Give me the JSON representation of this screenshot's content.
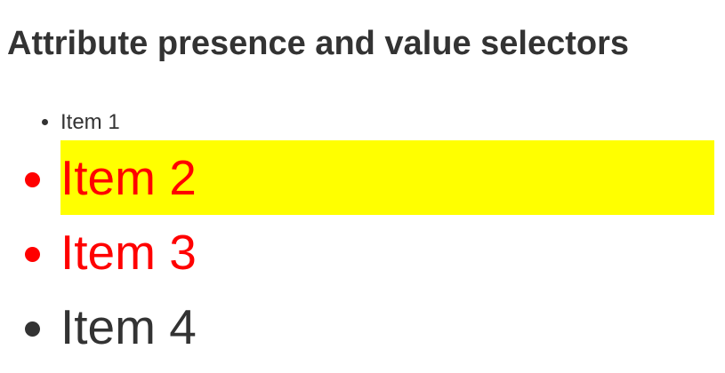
{
  "heading": "Attribute presence and value selectors",
  "items": [
    "Item 1",
    "Item 2",
    "Item 3",
    "Item 4"
  ]
}
